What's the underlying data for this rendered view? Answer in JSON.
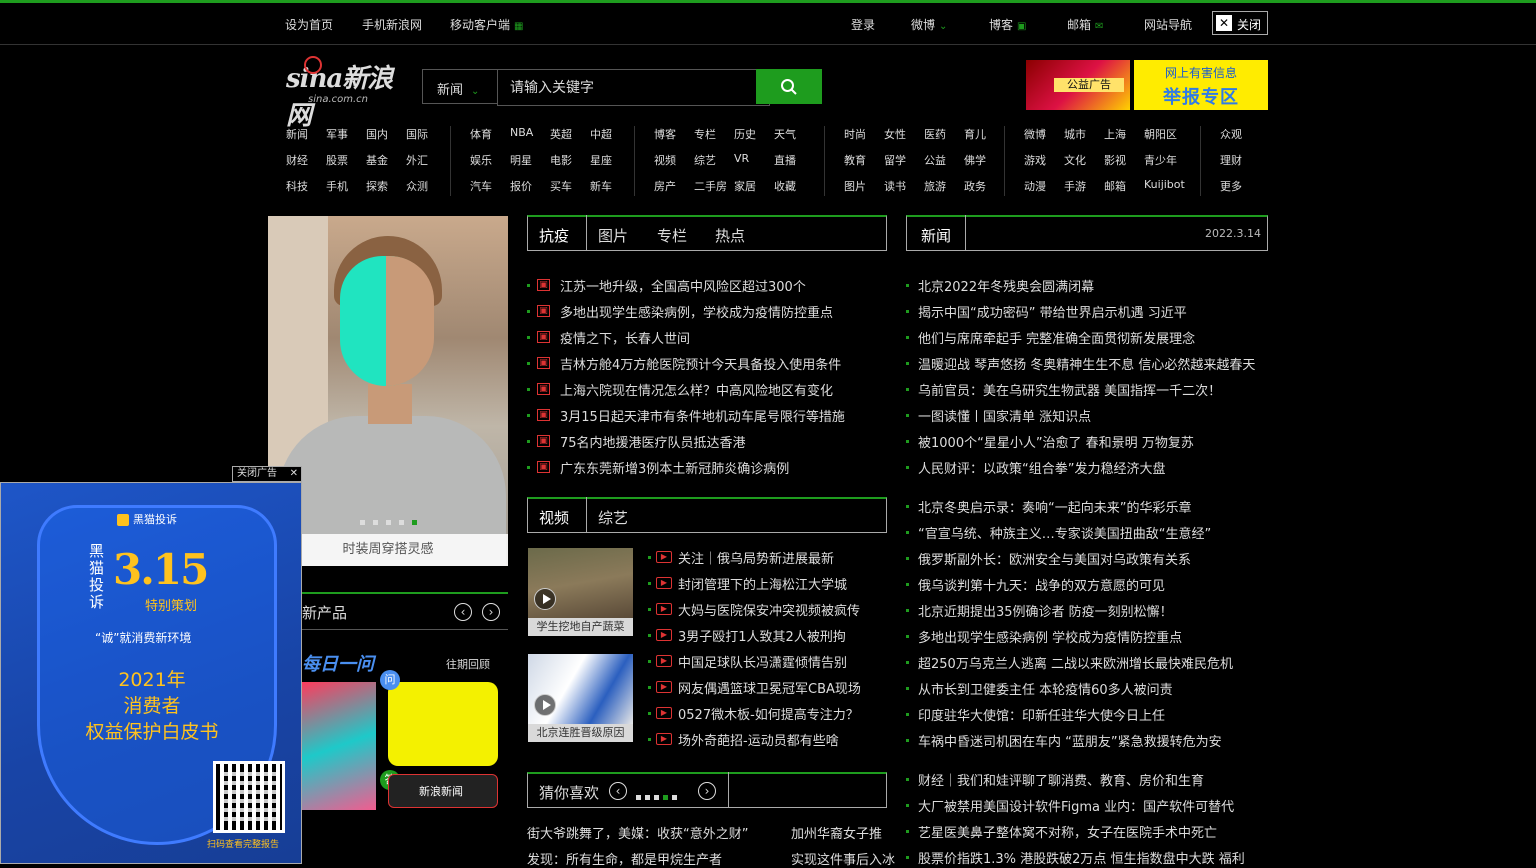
{
  "topbar": {
    "left": [
      "设为首页",
      "手机新浪网",
      "移动客户端"
    ],
    "right": [
      "登录",
      "微博",
      "博客",
      "邮箱",
      "网站导航"
    ],
    "close_label": "关闭"
  },
  "logo": {
    "name": "sina新浪网",
    "url_text": "sina.com.cn"
  },
  "search": {
    "category": "新闻",
    "placeholder": "请输入关键字"
  },
  "ads_top": {
    "ad1_text": "公益广告",
    "ad2_line1": "网上有害信息",
    "ad2_line2": "举报专区"
  },
  "nav": {
    "groups": [
      [
        "新闻",
        "军事",
        "国内",
        "国际",
        "财经",
        "股票",
        "基金",
        "外汇",
        "科技",
        "手机",
        "探索",
        "众测"
      ],
      [
        "体育",
        "NBA",
        "英超",
        "中超",
        "娱乐",
        "明星",
        "电影",
        "星座",
        "汽车",
        "报价",
        "买车",
        "新车"
      ],
      [
        "博客",
        "专栏",
        "历史",
        "天气",
        "视频",
        "综艺",
        "VR",
        "直播",
        "房产",
        "二手房",
        "家居",
        "收藏"
      ],
      [
        "时尚",
        "女性",
        "医药",
        "育儿",
        "教育",
        "留学",
        "公益",
        "佛学",
        "图片",
        "读书",
        "旅游",
        "政务"
      ],
      [
        "微博",
        "城市",
        "上海",
        "朝阳区",
        "游戏",
        "文化",
        "影视",
        "青少年",
        "动漫",
        "手游",
        "邮箱",
        "Kuijibot"
      ],
      [
        "众观",
        "理财",
        "更多"
      ]
    ]
  },
  "slider": {
    "caption": "时装周穿搭灵感"
  },
  "tabs_news": [
    "抗疫",
    "图片",
    "专栏",
    "热点"
  ],
  "news_left": [
    "江苏一地升级，全国高中风险区超过300个",
    "多地出现学生感染病例，学校成为疫情防控重点",
    "疫情之下，长春人世间",
    "吉林方舱4万方舱医院预计今天具备投入使用条件",
    "上海六院现在情况怎么样？中高风险地区有变化",
    "3月15日起天津市有条件地机动车尾号限行等措施",
    "75名内地援港医疗队员抵达香港",
    "广东东莞新增3例本土新冠肺炎确诊病例"
  ],
  "tabs_right": {
    "label": "新闻",
    "date": "2022.3.14"
  },
  "news_right_1": [
    "北京2022年冬残奥会圆满闭幕",
    "揭示中国“成功密码” 带给世界启示机遇 习近平",
    "他们与席席牵起手 完整准确全面贯彻新发展理念",
    "温暖迎战 琴声悠扬 冬奥精神生生不息 信心必然越来越春天",
    "乌前官员：美在乌研究生物武器 美国指挥一千二次！",
    "一图读懂丨国家清单 涨知识点",
    "被1000个“星星小人”治愈了 春和景明 万物复苏",
    "人民财评：以政策“组合拳”发力稳经济大盘"
  ],
  "tabs_video": [
    "视频",
    "综艺"
  ],
  "videos": [
    {
      "caption": "学生挖地自产蔬菜"
    },
    {
      "caption": "北京连胜晋级原因"
    }
  ],
  "video_list": [
    "关注｜俄乌局势新进展最新",
    "封闭管理下的上海松江大学城",
    "大妈与医院保安冲突视频被疯传",
    "3男子殴打1人致其2人被刑拘",
    "中国足球队长冯潇霆倾情告别",
    "网友偶遇篮球卫冕冠军CBA现场",
    "0527微木板-如何提高专注力？",
    "场外奇葩招-运动员都有些啥"
  ],
  "news_right_2": [
    "北京冬奥启示录：奏响“一起向未来”的华彩乐章",
    "“官宣乌统、种族主义…专家谈美国扭曲敌“生意经”",
    "俄罗斯副外长：欧洲安全与美国对乌政策有关系",
    "俄乌谈判第十九天：战争的双方意愿的可见",
    "北京近期提出35例确诊者 防疫一刻别松懈！",
    "多地出现学生感染病例 学校成为疫情防控重点",
    "超250万乌克兰人逃离 二战以来欧洲增长最快难民危机",
    "从市长到卫健委主任 本轮疫情60多人被问责",
    "印度驻华大使馆：印新任驻华大使今日上任",
    "车祸中昏迷司机困在车内 “蓝朋友”紧急救援转危为安"
  ],
  "news_right_3": [
    "财经｜我们和娃评聊了聊消费、教育、房价和生育",
    "大厂被禁用美国设计软件Figma 业内：国产软件可替代",
    "艺星医美鼻子整体窝不对称，女子在医院手术中死亡",
    "股票价指跌1.3% 港股跌破2万点 恒生指数盘中大跌 福利"
  ],
  "guess": {
    "title": "猜你喜欢",
    "rows": [
      "街大爷跳舞了，美媒：收获“意外之财”",
      "发现：所有生命，都是甲烷生产者",
      "加州华裔女子推",
      "实现这件事后入冰"
    ]
  },
  "products": {
    "title": "新产品",
    "past_label": "往期回顾",
    "daily_label": "每日一问",
    "ask": "问",
    "answer": "答",
    "card_label": "新浪新闻"
  },
  "float_ad": {
    "tag": "关闭广告",
    "brand": "黑猫投诉",
    "vertical": "黑猫投诉",
    "big": "3.15",
    "plan": "特别策划",
    "cheng": "“诚”就消费新环境",
    "year": "2021年",
    "line2": "消费者",
    "line3": "权益保护白皮书",
    "qr_text": "扫码查看完整报告"
  }
}
